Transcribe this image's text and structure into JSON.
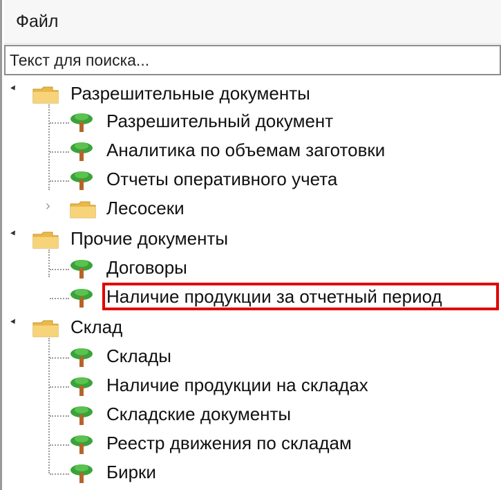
{
  "menu": {
    "file_label": "Файл"
  },
  "search": {
    "placeholder": "Текст для поиска..."
  },
  "tree": {
    "groups": [
      {
        "label": "Разрешительные документы",
        "icon": "folder-icon",
        "expanded": true,
        "children": [
          {
            "label": "Разрешительный документ",
            "icon": "tree-icon"
          },
          {
            "label": "Аналитика по объемам заготовки",
            "icon": "tree-icon"
          },
          {
            "label": "Отчеты оперативного учета",
            "icon": "tree-icon"
          },
          {
            "label": "Лесосеки",
            "icon": "folder-icon",
            "expanded": false
          }
        ]
      },
      {
        "label": "Прочие документы",
        "icon": "folder-icon",
        "expanded": true,
        "children": [
          {
            "label": "Договоры",
            "icon": "tree-icon"
          },
          {
            "label": "Наличие продукции за отчетный период",
            "icon": "tree-icon",
            "highlighted": true
          }
        ]
      },
      {
        "label": "Склад",
        "icon": "folder-icon",
        "expanded": true,
        "children": [
          {
            "label": "Склады",
            "icon": "tree-icon"
          },
          {
            "label": "Наличие продукции на складах",
            "icon": "tree-icon"
          },
          {
            "label": "Складские документы",
            "icon": "tree-icon"
          },
          {
            "label": "Реестр движения по складам",
            "icon": "tree-icon"
          },
          {
            "label": "Бирки",
            "icon": "tree-icon"
          }
        ]
      }
    ]
  },
  "colors": {
    "highlight": "#e00000",
    "folder": "#f2c14e",
    "tree_foliage": "#3aa23a",
    "tree_trunk": "#b5652a"
  }
}
